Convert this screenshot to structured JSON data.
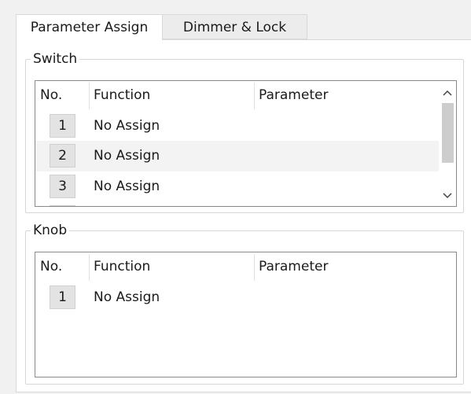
{
  "tabs": {
    "active_label": "Parameter Assign",
    "inactive_label": "Dimmer & Lock"
  },
  "switch_group": {
    "legend": "Switch",
    "headers": {
      "no": "No.",
      "function": "Function",
      "parameter": "Parameter"
    },
    "rows": [
      {
        "no": "1",
        "function": "No Assign"
      },
      {
        "no": "2",
        "function": "No Assign"
      },
      {
        "no": "3",
        "function": "No Assign"
      }
    ],
    "scroll_up_icon": "chevron-up",
    "scroll_down_icon": "chevron-down"
  },
  "knob_group": {
    "legend": "Knob",
    "headers": {
      "no": "No.",
      "function": "Function",
      "parameter": "Parameter"
    },
    "rows": [
      {
        "no": "1",
        "function": "No Assign"
      }
    ]
  }
}
